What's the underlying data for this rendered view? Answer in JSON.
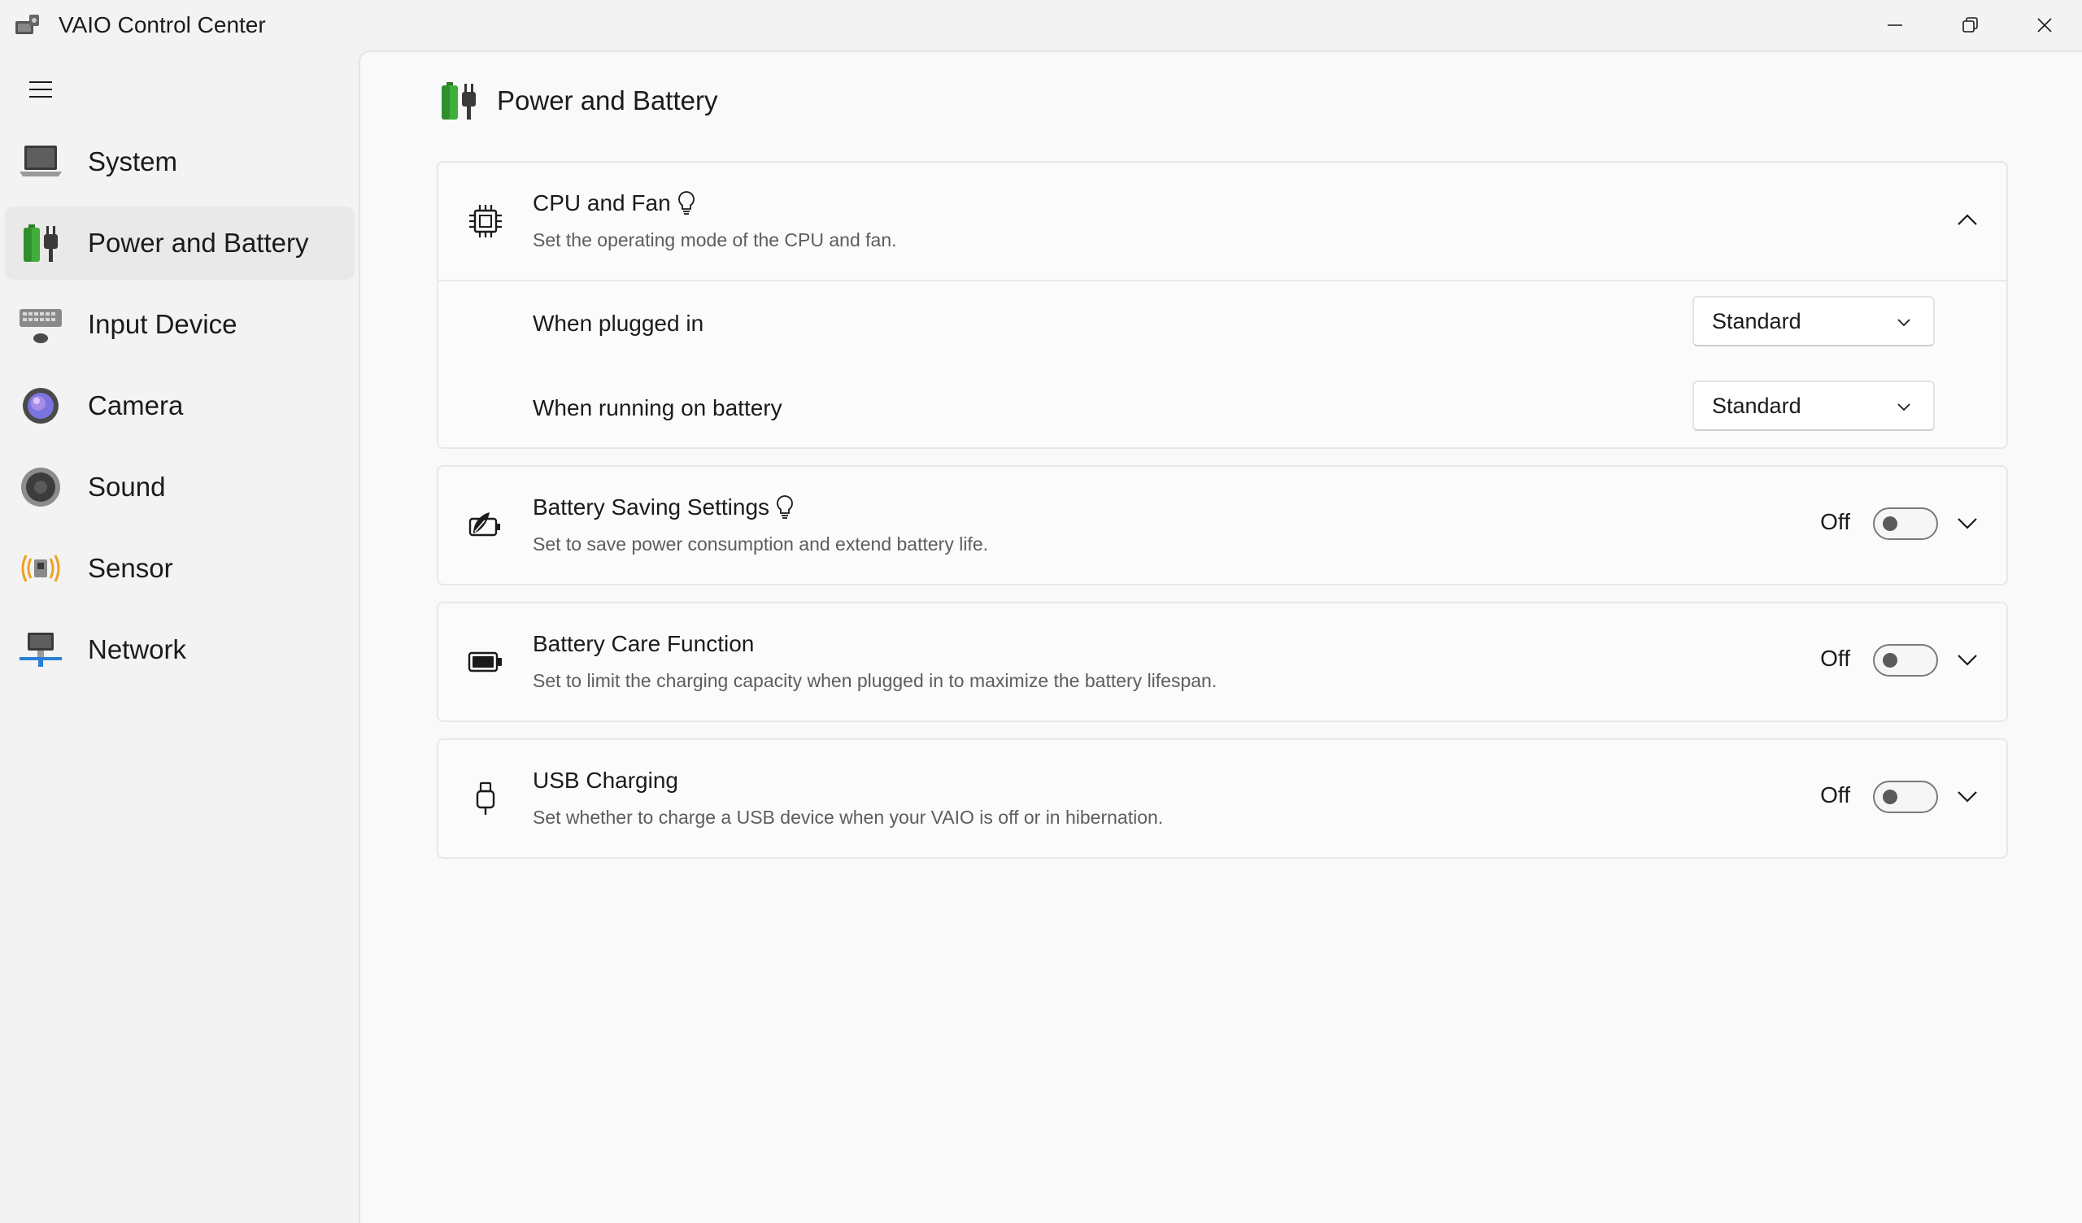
{
  "window": {
    "title": "VAIO Control Center"
  },
  "sidebar": {
    "items": [
      {
        "label": "System",
        "icon": "laptop-icon"
      },
      {
        "label": "Power and Battery",
        "icon": "power-battery-icon",
        "active": true
      },
      {
        "label": "Input Device",
        "icon": "keyboard-mouse-icon"
      },
      {
        "label": "Camera",
        "icon": "camera-icon"
      },
      {
        "label": "Sound",
        "icon": "speaker-icon"
      },
      {
        "label": "Sensor",
        "icon": "sensor-icon"
      },
      {
        "label": "Network",
        "icon": "network-icon"
      }
    ]
  },
  "page": {
    "title": "Power and Battery"
  },
  "cards": {
    "cpu_fan": {
      "title": "CPU and Fan",
      "description": "Set the operating mode of the CPU and fan.",
      "expanded": true,
      "rows": [
        {
          "label": "When plugged in",
          "value": "Standard"
        },
        {
          "label": "When running on battery",
          "value": "Standard"
        }
      ]
    },
    "battery_saving": {
      "title": "Battery Saving Settings",
      "description": "Set to save power consumption and extend battery life.",
      "state": "Off"
    },
    "battery_care": {
      "title": "Battery Care Function",
      "description": "Set to limit the charging capacity when plugged in to maximize the battery lifespan.",
      "state": "Off"
    },
    "usb_charging": {
      "title": "USB Charging",
      "description": "Set whether to charge a USB device when your VAIO is off or in hibernation.",
      "state": "Off"
    }
  },
  "colors": {
    "accent_green": "#3fae3a",
    "sidebar_active": "#e9e9e9",
    "sensor_orange": "#f0a020",
    "network_blue": "#2a7fd6"
  }
}
